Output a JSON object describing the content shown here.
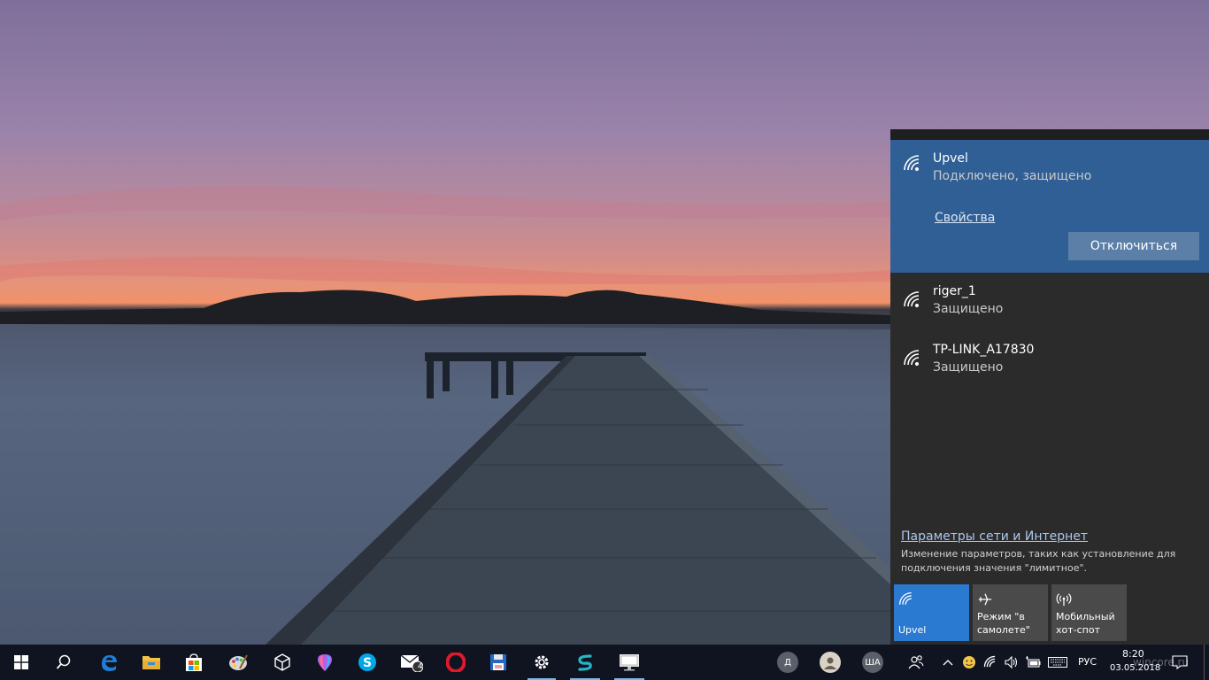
{
  "networks": {
    "active": {
      "name": "Upvel",
      "status": "Подключено, защищено",
      "properties_link": "Свойства",
      "disconnect_label": "Отключиться"
    },
    "others": [
      {
        "name": "riger_1",
        "status": "Защищено"
      },
      {
        "name": "TP-LINK_A17830",
        "status": "Защищено"
      }
    ],
    "settings_link": "Параметры сети и Интернет",
    "settings_desc": "Изменение параметров, таких как установление для подключения значения \"лимитное\"."
  },
  "quick_actions": [
    {
      "label": "Upvel",
      "on": true
    },
    {
      "label": "Режим \"в самолете\"",
      "on": false
    },
    {
      "label": "Мобильный хот-спот",
      "on": false
    }
  ],
  "taskbar": {
    "mail_badge": "4",
    "people": [
      "Д",
      "ША"
    ],
    "language": "РУС",
    "time": "8:20",
    "date": "03.05.2018",
    "watermark": "wincore.ru"
  }
}
